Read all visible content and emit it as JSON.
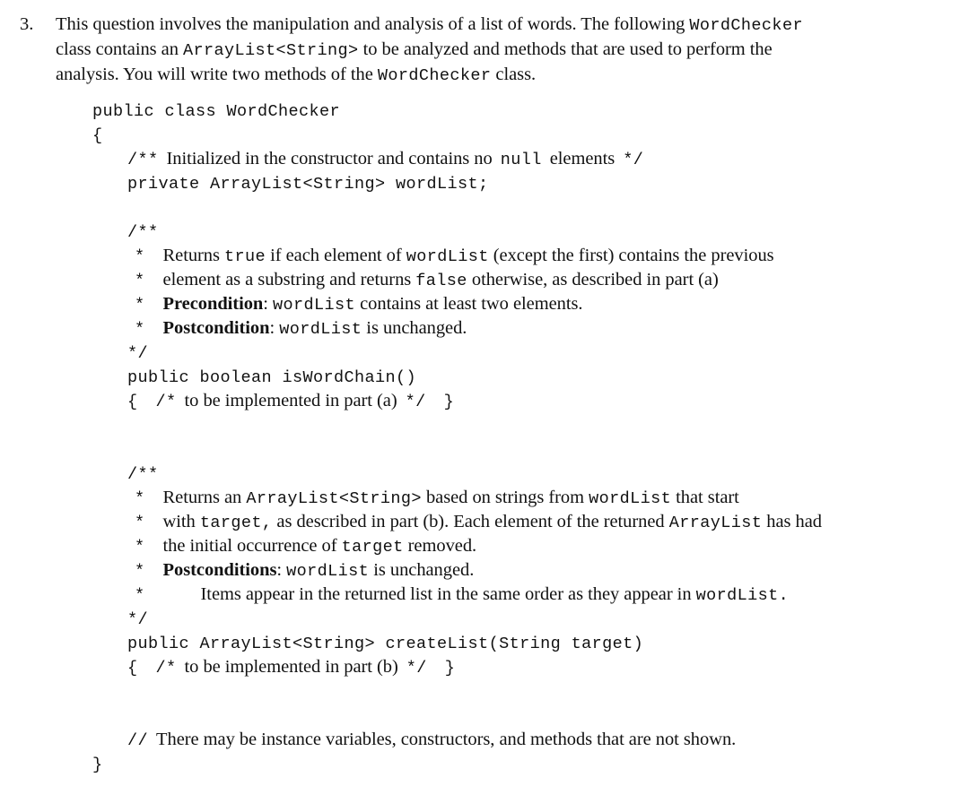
{
  "document": {
    "question_number": "3.",
    "intro_lines": [
      [
        {
          "t": "prose",
          "v": "This question involves the manipulation and analysis of a list of words. The following "
        },
        {
          "t": "mono",
          "v": "WordChecker"
        }
      ],
      [
        {
          "t": "prose",
          "v": "class contains an "
        },
        {
          "t": "mono",
          "v": "ArrayList<String>"
        },
        {
          "t": "prose",
          "v": " to be analyzed and methods that are used to perform the"
        }
      ],
      [
        {
          "t": "prose",
          "v": "analysis. You will write two methods of the "
        },
        {
          "t": "mono",
          "v": "WordChecker"
        },
        {
          "t": "prose",
          "v": " class."
        }
      ]
    ]
  },
  "code": {
    "lines": [
      {
        "indent": "i0",
        "runs": [
          {
            "t": "mono",
            "v": "public class WordChecker"
          }
        ]
      },
      {
        "indent": "i0",
        "runs": [
          {
            "t": "mono",
            "v": "{"
          }
        ]
      },
      {
        "indent": "i1",
        "runs": [
          {
            "t": "mono",
            "v": "/**"
          },
          {
            "t": "gap",
            "v": "sm"
          },
          {
            "t": "prose",
            "v": "Initialized in the constructor and contains no"
          },
          {
            "t": "gap",
            "v": "sm"
          },
          {
            "t": "mono",
            "v": "null"
          },
          {
            "t": "gap",
            "v": "sm"
          },
          {
            "t": "prose",
            "v": "elements"
          },
          {
            "t": "gap",
            "v": "sm"
          },
          {
            "t": "mono",
            "v": "*/"
          }
        ]
      },
      {
        "indent": "i1",
        "runs": [
          {
            "t": "mono",
            "v": "private ArrayList<String> wordList;"
          }
        ]
      },
      {
        "indent": "i1",
        "blank": true,
        "runs": []
      },
      {
        "indent": "i1",
        "runs": [
          {
            "t": "mono",
            "v": "/**"
          }
        ]
      },
      {
        "indent": "i2",
        "runs": [
          {
            "t": "mono",
            "v": "*"
          },
          {
            "t": "gap",
            "v": "md"
          },
          {
            "t": "prose",
            "v": "Returns "
          },
          {
            "t": "mono",
            "v": "true"
          },
          {
            "t": "prose",
            "v": " if each element of "
          },
          {
            "t": "mono",
            "v": "wordList"
          },
          {
            "t": "prose",
            "v": " (except the first) contains the previous"
          }
        ]
      },
      {
        "indent": "i2",
        "runs": [
          {
            "t": "mono",
            "v": "*"
          },
          {
            "t": "gap",
            "v": "md"
          },
          {
            "t": "prose",
            "v": "element as a substring and returns "
          },
          {
            "t": "mono",
            "v": "false"
          },
          {
            "t": "prose",
            "v": " otherwise, as described in part (a)"
          }
        ]
      },
      {
        "indent": "i2",
        "runs": [
          {
            "t": "mono",
            "v": "*"
          },
          {
            "t": "gap",
            "v": "md"
          },
          {
            "t": "bold",
            "v": "Precondition"
          },
          {
            "t": "prose",
            "v": ": "
          },
          {
            "t": "mono",
            "v": "wordList"
          },
          {
            "t": "prose",
            "v": " contains at least two elements."
          }
        ]
      },
      {
        "indent": "i2",
        "runs": [
          {
            "t": "mono",
            "v": "*"
          },
          {
            "t": "gap",
            "v": "md"
          },
          {
            "t": "bold",
            "v": "Postcondition"
          },
          {
            "t": "prose",
            "v": ": "
          },
          {
            "t": "mono",
            "v": "wordList"
          },
          {
            "t": "prose",
            "v": " is unchanged."
          }
        ]
      },
      {
        "indent": "i1",
        "runs": [
          {
            "t": "mono",
            "v": "*/"
          }
        ]
      },
      {
        "indent": "i1",
        "runs": [
          {
            "t": "mono",
            "v": "public boolean isWordChain()"
          }
        ]
      },
      {
        "indent": "i1",
        "runs": [
          {
            "t": "mono",
            "v": "{"
          },
          {
            "t": "gap",
            "v": "md"
          },
          {
            "t": "mono",
            "v": "/*"
          },
          {
            "t": "gap",
            "v": "sm"
          },
          {
            "t": "prose",
            "v": "to be implemented in part (a)"
          },
          {
            "t": "gap",
            "v": "sm"
          },
          {
            "t": "mono",
            "v": "*/"
          },
          {
            "t": "gap",
            "v": "md"
          },
          {
            "t": "mono",
            "v": "}"
          }
        ]
      },
      {
        "indent": "i1",
        "blank": true,
        "runs": []
      },
      {
        "indent": "i1",
        "blank": true,
        "runs": []
      },
      {
        "indent": "i1",
        "runs": [
          {
            "t": "mono",
            "v": "/**"
          }
        ]
      },
      {
        "indent": "i2",
        "runs": [
          {
            "t": "mono",
            "v": "*"
          },
          {
            "t": "gap",
            "v": "md"
          },
          {
            "t": "prose",
            "v": "Returns an "
          },
          {
            "t": "mono",
            "v": "ArrayList<String>"
          },
          {
            "t": "prose",
            "v": " based on strings from "
          },
          {
            "t": "mono",
            "v": "wordList"
          },
          {
            "t": "prose",
            "v": " that start"
          }
        ]
      },
      {
        "indent": "i2",
        "runs": [
          {
            "t": "mono",
            "v": "*"
          },
          {
            "t": "gap",
            "v": "md"
          },
          {
            "t": "prose",
            "v": "with "
          },
          {
            "t": "mono",
            "v": "target,"
          },
          {
            "t": "prose",
            "v": " as described in part (b). Each element of the returned "
          },
          {
            "t": "mono",
            "v": "ArrayList"
          },
          {
            "t": "prose",
            "v": " has had"
          }
        ]
      },
      {
        "indent": "i2",
        "runs": [
          {
            "t": "mono",
            "v": "*"
          },
          {
            "t": "gap",
            "v": "md"
          },
          {
            "t": "prose",
            "v": "the initial occurrence of "
          },
          {
            "t": "mono",
            "v": "target"
          },
          {
            "t": "prose",
            "v": " removed."
          }
        ]
      },
      {
        "indent": "i2",
        "runs": [
          {
            "t": "mono",
            "v": "*"
          },
          {
            "t": "gap",
            "v": "md"
          },
          {
            "t": "bold",
            "v": "Postconditions"
          },
          {
            "t": "prose",
            "v": ": "
          },
          {
            "t": "mono",
            "v": "wordList"
          },
          {
            "t": "prose",
            "v": " is unchanged."
          }
        ]
      },
      {
        "indent": "i2",
        "runs": [
          {
            "t": "mono",
            "v": "*"
          },
          {
            "t": "gap",
            "v": "xl"
          },
          {
            "t": "prose",
            "v": "Items appear in the returned list in the same order as they appear in "
          },
          {
            "t": "mono",
            "v": "wordList."
          }
        ]
      },
      {
        "indent": "i1",
        "runs": [
          {
            "t": "mono",
            "v": "*/"
          }
        ]
      },
      {
        "indent": "i1",
        "runs": [
          {
            "t": "mono",
            "v": "public ArrayList<String> createList(String target)"
          }
        ]
      },
      {
        "indent": "i1",
        "runs": [
          {
            "t": "mono",
            "v": "{"
          },
          {
            "t": "gap",
            "v": "md"
          },
          {
            "t": "mono",
            "v": "/*"
          },
          {
            "t": "gap",
            "v": "sm"
          },
          {
            "t": "prose",
            "v": "to be implemented in part (b)"
          },
          {
            "t": "gap",
            "v": "sm"
          },
          {
            "t": "mono",
            "v": "*/"
          },
          {
            "t": "gap",
            "v": "md"
          },
          {
            "t": "mono",
            "v": "}"
          }
        ]
      },
      {
        "indent": "i1",
        "blank": true,
        "runs": []
      },
      {
        "indent": "i1",
        "blank": true,
        "runs": []
      },
      {
        "indent": "i1",
        "runs": [
          {
            "t": "mono",
            "v": "//"
          },
          {
            "t": "gap",
            "v": "sm"
          },
          {
            "t": "prose",
            "v": "There may be instance variables, constructors, and methods that are not shown."
          }
        ]
      },
      {
        "indent": "i0",
        "runs": [
          {
            "t": "mono",
            "v": "}"
          }
        ]
      }
    ]
  }
}
